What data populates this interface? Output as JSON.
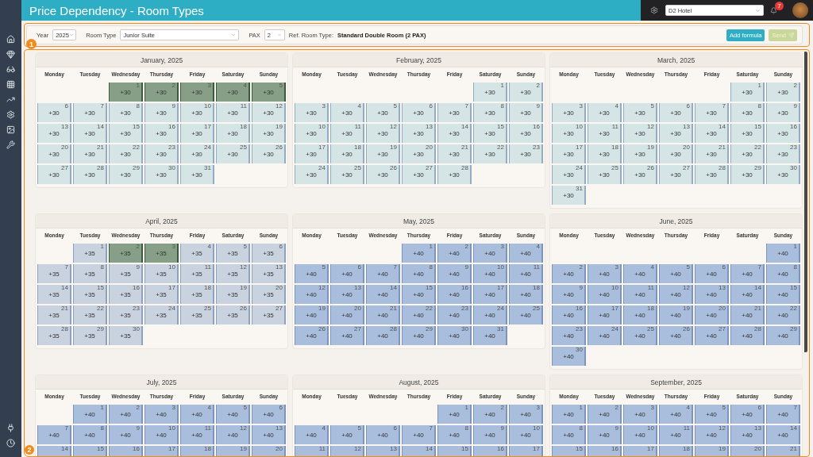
{
  "header": {
    "title": "Price Dependency - Room Types",
    "hotel_select": {
      "value": "D2 Hotel"
    },
    "notification_count": "7"
  },
  "annotations": [
    {
      "label": "1"
    },
    {
      "label": "2"
    }
  ],
  "toolbar": {
    "year": {
      "label": "Year",
      "value": "2025"
    },
    "room_type": {
      "label": "Room Type",
      "value": "Junior Suite"
    },
    "pax": {
      "label": "PAX",
      "value": "2"
    },
    "ref_room_type": {
      "label": "Ref. Room Type:",
      "value": "Standard Double Room (2 PAX)"
    },
    "buttons": [
      {
        "label": "Add formula",
        "disabled": false
      },
      {
        "label": "Send",
        "disabled": true
      }
    ]
  },
  "months": [
    {
      "title": "January, 2025",
      "color": "#d5e5e6",
      "weekdays": [
        "Monday",
        "Tuesday",
        "Wednesday",
        "Thursday",
        "Friday",
        "Saturday",
        "Sunday"
      ],
      "cells": [
        null,
        null,
        {
          "day": "1",
          "value": "+30",
          "selected": true
        },
        {
          "day": "2",
          "value": "+30",
          "selected": true
        },
        {
          "day": "3",
          "value": "+30",
          "selected": true
        },
        {
          "day": "4",
          "value": "+30",
          "selected": true
        },
        {
          "day": "5",
          "value": "+30",
          "selected": true
        },
        {
          "day": "6",
          "value": "+30",
          "selected": false
        },
        {
          "day": "7",
          "value": "+30",
          "selected": false
        },
        {
          "day": "8",
          "value": "+30",
          "selected": false
        },
        {
          "day": "9",
          "value": "+30",
          "selected": false
        },
        {
          "day": "10",
          "value": "+30",
          "selected": false
        },
        {
          "day": "11",
          "value": "+30",
          "selected": false
        },
        {
          "day": "12",
          "value": "+30",
          "selected": false
        },
        {
          "day": "13",
          "value": "+30",
          "selected": false
        },
        {
          "day": "14",
          "value": "+30",
          "selected": false
        },
        {
          "day": "15",
          "value": "+30",
          "selected": false
        },
        {
          "day": "16",
          "value": "+30",
          "selected": false
        },
        {
          "day": "17",
          "value": "+30",
          "selected": false
        },
        {
          "day": "18",
          "value": "+30",
          "selected": false
        },
        {
          "day": "19",
          "value": "+30",
          "selected": false
        },
        {
          "day": "20",
          "value": "+30",
          "selected": false
        },
        {
          "day": "21",
          "value": "+30",
          "selected": false
        },
        {
          "day": "22",
          "value": "+30",
          "selected": false
        },
        {
          "day": "23",
          "value": "+30",
          "selected": false
        },
        {
          "day": "24",
          "value": "+30",
          "selected": false
        },
        {
          "day": "25",
          "value": "+30",
          "selected": false
        },
        {
          "day": "26",
          "value": "+30",
          "selected": false
        },
        {
          "day": "27",
          "value": "+30",
          "selected": false
        },
        {
          "day": "28",
          "value": "+30",
          "selected": false
        },
        {
          "day": "29",
          "value": "+30",
          "selected": false
        },
        {
          "day": "30",
          "value": "+30",
          "selected": false
        },
        {
          "day": "31",
          "value": "+30",
          "selected": false
        }
      ]
    },
    {
      "title": "February, 2025",
      "color": "#d5e5e6",
      "weekdays": [
        "Monday",
        "Tuesday",
        "Wednesday",
        "Thursday",
        "Friday",
        "Saturday",
        "Sunday"
      ],
      "cells": [
        null,
        null,
        null,
        null,
        null,
        {
          "day": "1",
          "value": "+30",
          "selected": false
        },
        {
          "day": "2",
          "value": "+30",
          "selected": false
        },
        {
          "day": "3",
          "value": "+30",
          "selected": false
        },
        {
          "day": "4",
          "value": "+30",
          "selected": false
        },
        {
          "day": "5",
          "value": "+30",
          "selected": false
        },
        {
          "day": "6",
          "value": "+30",
          "selected": false
        },
        {
          "day": "7",
          "value": "+30",
          "selected": false
        },
        {
          "day": "8",
          "value": "+30",
          "selected": false
        },
        {
          "day": "9",
          "value": "+30",
          "selected": false
        },
        {
          "day": "10",
          "value": "+30",
          "selected": false
        },
        {
          "day": "11",
          "value": "+30",
          "selected": false
        },
        {
          "day": "12",
          "value": "+30",
          "selected": false
        },
        {
          "day": "13",
          "value": "+30",
          "selected": false
        },
        {
          "day": "14",
          "value": "+30",
          "selected": false
        },
        {
          "day": "15",
          "value": "+30",
          "selected": false
        },
        {
          "day": "16",
          "value": "+30",
          "selected": false
        },
        {
          "day": "17",
          "value": "+30",
          "selected": false
        },
        {
          "day": "18",
          "value": "+30",
          "selected": false
        },
        {
          "day": "19",
          "value": "+30",
          "selected": false
        },
        {
          "day": "20",
          "value": "+30",
          "selected": false
        },
        {
          "day": "21",
          "value": "+30",
          "selected": false
        },
        {
          "day": "22",
          "value": "+30",
          "selected": false
        },
        {
          "day": "23",
          "value": "+30",
          "selected": false
        },
        {
          "day": "24",
          "value": "+30",
          "selected": false
        },
        {
          "day": "25",
          "value": "+30",
          "selected": false
        },
        {
          "day": "26",
          "value": "+30",
          "selected": false
        },
        {
          "day": "27",
          "value": "+30",
          "selected": false
        },
        {
          "day": "28",
          "value": "+30",
          "selected": false
        }
      ]
    },
    {
      "title": "March, 2025",
      "color": "#d5e5e6",
      "weekdays": [
        "Monday",
        "Tuesday",
        "Wednesday",
        "Thursday",
        "Friday",
        "Saturday",
        "Sunday"
      ],
      "cells": [
        null,
        null,
        null,
        null,
        null,
        {
          "day": "1",
          "value": "+30",
          "selected": false
        },
        {
          "day": "2",
          "value": "+30",
          "selected": false
        },
        {
          "day": "3",
          "value": "+30",
          "selected": false
        },
        {
          "day": "4",
          "value": "+30",
          "selected": false
        },
        {
          "day": "5",
          "value": "+30",
          "selected": false
        },
        {
          "day": "6",
          "value": "+30",
          "selected": false
        },
        {
          "day": "7",
          "value": "+30",
          "selected": false
        },
        {
          "day": "8",
          "value": "+30",
          "selected": false
        },
        {
          "day": "9",
          "value": "+30",
          "selected": false
        },
        {
          "day": "10",
          "value": "+30",
          "selected": false
        },
        {
          "day": "11",
          "value": "+30",
          "selected": false
        },
        {
          "day": "12",
          "value": "+30",
          "selected": false
        },
        {
          "day": "13",
          "value": "+30",
          "selected": false
        },
        {
          "day": "14",
          "value": "+30",
          "selected": false
        },
        {
          "day": "15",
          "value": "+30",
          "selected": false
        },
        {
          "day": "16",
          "value": "+30",
          "selected": false
        },
        {
          "day": "17",
          "value": "+30",
          "selected": false
        },
        {
          "day": "18",
          "value": "+30",
          "selected": false
        },
        {
          "day": "19",
          "value": "+30",
          "selected": false
        },
        {
          "day": "20",
          "value": "+30",
          "selected": false
        },
        {
          "day": "21",
          "value": "+30",
          "selected": false
        },
        {
          "day": "22",
          "value": "+30",
          "selected": false
        },
        {
          "day": "23",
          "value": "+30",
          "selected": false
        },
        {
          "day": "24",
          "value": "+30",
          "selected": false
        },
        {
          "day": "25",
          "value": "+30",
          "selected": false
        },
        {
          "day": "26",
          "value": "+30",
          "selected": false
        },
        {
          "day": "27",
          "value": "+30",
          "selected": false
        },
        {
          "day": "28",
          "value": "+30",
          "selected": false
        },
        {
          "day": "29",
          "value": "+30",
          "selected": false
        },
        {
          "day": "30",
          "value": "+30",
          "selected": false
        },
        {
          "day": "31",
          "value": "+30",
          "selected": false
        }
      ]
    },
    {
      "title": "April, 2025",
      "color": "#c9d3e0",
      "weekdays": [
        "Monday",
        "Tuesday",
        "Wednesday",
        "Thursday",
        "Friday",
        "Saturday",
        "Sunday"
      ],
      "cells": [
        null,
        {
          "day": "1",
          "value": "+35",
          "selected": false
        },
        {
          "day": "2",
          "value": "+35",
          "selected": true
        },
        {
          "day": "3",
          "value": "+35",
          "selected": true
        },
        {
          "day": "4",
          "value": "+35",
          "selected": false
        },
        {
          "day": "5",
          "value": "+35",
          "selected": false
        },
        {
          "day": "6",
          "value": "+35",
          "selected": false
        },
        {
          "day": "7",
          "value": "+35",
          "selected": false
        },
        {
          "day": "8",
          "value": "+35",
          "selected": false
        },
        {
          "day": "9",
          "value": "+35",
          "selected": false
        },
        {
          "day": "10",
          "value": "+35",
          "selected": false
        },
        {
          "day": "11",
          "value": "+35",
          "selected": false
        },
        {
          "day": "12",
          "value": "+35",
          "selected": false
        },
        {
          "day": "13",
          "value": "+35",
          "selected": false
        },
        {
          "day": "14",
          "value": "+35",
          "selected": false
        },
        {
          "day": "15",
          "value": "+35",
          "selected": false
        },
        {
          "day": "16",
          "value": "+35",
          "selected": false
        },
        {
          "day": "17",
          "value": "+35",
          "selected": false
        },
        {
          "day": "18",
          "value": "+35",
          "selected": false
        },
        {
          "day": "19",
          "value": "+35",
          "selected": false
        },
        {
          "day": "20",
          "value": "+35",
          "selected": false
        },
        {
          "day": "21",
          "value": "+35",
          "selected": false
        },
        {
          "day": "22",
          "value": "+35",
          "selected": false
        },
        {
          "day": "23",
          "value": "+35",
          "selected": false
        },
        {
          "day": "24",
          "value": "+35",
          "selected": false
        },
        {
          "day": "25",
          "value": "+35",
          "selected": false
        },
        {
          "day": "26",
          "value": "+35",
          "selected": false
        },
        {
          "day": "27",
          "value": "+35",
          "selected": false
        },
        {
          "day": "28",
          "value": "+35",
          "selected": false
        },
        {
          "day": "29",
          "value": "+35",
          "selected": false
        },
        {
          "day": "30",
          "value": "+35",
          "selected": false
        }
      ]
    },
    {
      "title": "May, 2025",
      "color": "#a9bedd",
      "weekdays": [
        "Monday",
        "Tuesday",
        "Wednesday",
        "Thursday",
        "Friday",
        "Saturday",
        "Sunday"
      ],
      "cells": [
        null,
        null,
        null,
        {
          "day": "1",
          "value": "+40",
          "selected": false
        },
        {
          "day": "2",
          "value": "+40",
          "selected": false
        },
        {
          "day": "3",
          "value": "+40",
          "selected": false
        },
        {
          "day": "4",
          "value": "+40",
          "selected": false
        },
        {
          "day": "5",
          "value": "+40",
          "selected": false
        },
        {
          "day": "6",
          "value": "+40",
          "selected": false
        },
        {
          "day": "7",
          "value": "+40",
          "selected": false
        },
        {
          "day": "8",
          "value": "+40",
          "selected": false
        },
        {
          "day": "9",
          "value": "+40",
          "selected": false
        },
        {
          "day": "10",
          "value": "+40",
          "selected": false
        },
        {
          "day": "11",
          "value": "+40",
          "selected": false
        },
        {
          "day": "12",
          "value": "+40",
          "selected": false
        },
        {
          "day": "13",
          "value": "+40",
          "selected": false
        },
        {
          "day": "14",
          "value": "+40",
          "selected": false
        },
        {
          "day": "15",
          "value": "+40",
          "selected": false
        },
        {
          "day": "16",
          "value": "+40",
          "selected": false
        },
        {
          "day": "17",
          "value": "+40",
          "selected": false
        },
        {
          "day": "18",
          "value": "+40",
          "selected": false
        },
        {
          "day": "19",
          "value": "+40",
          "selected": false
        },
        {
          "day": "20",
          "value": "+40",
          "selected": false
        },
        {
          "day": "21",
          "value": "+40",
          "selected": false
        },
        {
          "day": "22",
          "value": "+40",
          "selected": false
        },
        {
          "day": "23",
          "value": "+40",
          "selected": false
        },
        {
          "day": "24",
          "value": "+40",
          "selected": false
        },
        {
          "day": "25",
          "value": "+40",
          "selected": false
        },
        {
          "day": "26",
          "value": "+40",
          "selected": false
        },
        {
          "day": "27",
          "value": "+40",
          "selected": false
        },
        {
          "day": "28",
          "value": "+40",
          "selected": false
        },
        {
          "day": "29",
          "value": "+40",
          "selected": false
        },
        {
          "day": "30",
          "value": "+40",
          "selected": false
        },
        {
          "day": "31",
          "value": "+40",
          "selected": false
        }
      ]
    },
    {
      "title": "June, 2025",
      "color": "#a9bedd",
      "weekdays": [
        "Monday",
        "Tuesday",
        "Wednesday",
        "Thursday",
        "Friday",
        "Saturday",
        "Sunday"
      ],
      "cells": [
        null,
        null,
        null,
        null,
        null,
        null,
        {
          "day": "1",
          "value": "+40",
          "selected": false
        },
        {
          "day": "2",
          "value": "+40",
          "selected": false
        },
        {
          "day": "3",
          "value": "+40",
          "selected": false
        },
        {
          "day": "4",
          "value": "+40",
          "selected": false
        },
        {
          "day": "5",
          "value": "+40",
          "selected": false
        },
        {
          "day": "6",
          "value": "+40",
          "selected": false
        },
        {
          "day": "7",
          "value": "+40",
          "selected": false
        },
        {
          "day": "8",
          "value": "+40",
          "selected": false
        },
        {
          "day": "9",
          "value": "+40",
          "selected": false
        },
        {
          "day": "10",
          "value": "+40",
          "selected": false
        },
        {
          "day": "11",
          "value": "+40",
          "selected": false
        },
        {
          "day": "12",
          "value": "+40",
          "selected": false
        },
        {
          "day": "13",
          "value": "+40",
          "selected": false
        },
        {
          "day": "14",
          "value": "+40",
          "selected": false
        },
        {
          "day": "15",
          "value": "+40",
          "selected": false
        },
        {
          "day": "16",
          "value": "+40",
          "selected": false
        },
        {
          "day": "17",
          "value": "+40",
          "selected": false
        },
        {
          "day": "18",
          "value": "+40",
          "selected": false
        },
        {
          "day": "19",
          "value": "+40",
          "selected": false
        },
        {
          "day": "20",
          "value": "+40",
          "selected": false
        },
        {
          "day": "21",
          "value": "+40",
          "selected": false
        },
        {
          "day": "22",
          "value": "+40",
          "selected": false
        },
        {
          "day": "23",
          "value": "+40",
          "selected": false
        },
        {
          "day": "24",
          "value": "+40",
          "selected": false
        },
        {
          "day": "25",
          "value": "+40",
          "selected": false
        },
        {
          "day": "26",
          "value": "+40",
          "selected": false
        },
        {
          "day": "27",
          "value": "+40",
          "selected": false
        },
        {
          "day": "28",
          "value": "+40",
          "selected": false
        },
        {
          "day": "29",
          "value": "+40",
          "selected": false
        },
        {
          "day": "30",
          "value": "+40",
          "selected": false
        }
      ]
    },
    {
      "title": "July, 2025",
      "color": "#a9bedd",
      "weekdays": [
        "Monday",
        "Tuesday",
        "Wednesday",
        "Thursday",
        "Friday",
        "Saturday",
        "Sunday"
      ],
      "cells": [
        null,
        {
          "day": "1",
          "value": "+40",
          "selected": false
        },
        {
          "day": "2",
          "value": "+40",
          "selected": false
        },
        {
          "day": "3",
          "value": "+40",
          "selected": false
        },
        {
          "day": "4",
          "value": "+40",
          "selected": false
        },
        {
          "day": "5",
          "value": "+40",
          "selected": false
        },
        {
          "day": "6",
          "value": "+40",
          "selected": false
        },
        {
          "day": "7",
          "value": "+40",
          "selected": false
        },
        {
          "day": "8",
          "value": "+40",
          "selected": false
        },
        {
          "day": "9",
          "value": "+40",
          "selected": false
        },
        {
          "day": "10",
          "value": "+40",
          "selected": false
        },
        {
          "day": "11",
          "value": "+40",
          "selected": false
        },
        {
          "day": "12",
          "value": "+40",
          "selected": false
        },
        {
          "day": "13",
          "value": "+40",
          "selected": false
        },
        {
          "day": "14",
          "selected": false
        },
        {
          "day": "15",
          "selected": false
        },
        {
          "day": "16",
          "selected": false
        },
        {
          "day": "17",
          "selected": false
        },
        {
          "day": "18",
          "selected": false
        },
        {
          "day": "19",
          "selected": false
        },
        {
          "day": "20",
          "selected": false
        }
      ]
    },
    {
      "title": "August, 2025",
      "color": "#a9bedd",
      "weekdays": [
        "Monday",
        "Tuesday",
        "Wednesday",
        "Thursday",
        "Friday",
        "Saturday",
        "Sunday"
      ],
      "cells": [
        null,
        null,
        null,
        null,
        {
          "day": "1",
          "value": "+40",
          "selected": false
        },
        {
          "day": "2",
          "value": "+40",
          "selected": false
        },
        {
          "day": "3",
          "value": "+40",
          "selected": false
        },
        {
          "day": "4",
          "value": "+40",
          "selected": false
        },
        {
          "day": "5",
          "value": "+40",
          "selected": false
        },
        {
          "day": "6",
          "value": "+40",
          "selected": false
        },
        {
          "day": "7",
          "value": "+40",
          "selected": false
        },
        {
          "day": "8",
          "value": "+40",
          "selected": false
        },
        {
          "day": "9",
          "value": "+40",
          "selected": false
        },
        {
          "day": "10",
          "value": "+40",
          "selected": false
        },
        {
          "day": "11",
          "selected": false
        },
        {
          "day": "12",
          "selected": false
        },
        {
          "day": "13",
          "selected": false
        },
        {
          "day": "14",
          "selected": false
        },
        {
          "day": "15",
          "selected": false
        },
        {
          "day": "16",
          "selected": false
        },
        {
          "day": "17",
          "selected": false
        }
      ]
    },
    {
      "title": "September, 2025",
      "color": "#a9bedd",
      "weekdays": [
        "Monday",
        "Tuesday",
        "Wednesday",
        "Thursday",
        "Friday",
        "Saturday",
        "Sunday"
      ],
      "cells": [
        {
          "day": "1",
          "value": "+40",
          "selected": false
        },
        {
          "day": "2",
          "value": "+40",
          "selected": false
        },
        {
          "day": "3",
          "value": "+40",
          "selected": false
        },
        {
          "day": "4",
          "value": "+40",
          "selected": false
        },
        {
          "day": "5",
          "value": "+40",
          "selected": false
        },
        {
          "day": "6",
          "value": "+40",
          "selected": false
        },
        {
          "day": "7",
          "value": "+40",
          "selected": false
        },
        {
          "day": "8",
          "value": "+40",
          "selected": false
        },
        {
          "day": "9",
          "value": "+40",
          "selected": false
        },
        {
          "day": "10",
          "value": "+40",
          "selected": false
        },
        {
          "day": "11",
          "value": "+40",
          "selected": false
        },
        {
          "day": "12",
          "value": "+40",
          "selected": false
        },
        {
          "day": "13",
          "value": "+40",
          "selected": false
        },
        {
          "day": "14",
          "value": "+40",
          "selected": false
        },
        {
          "day": "15",
          "selected": false
        },
        {
          "day": "16",
          "selected": false
        },
        {
          "day": "17",
          "selected": false
        },
        {
          "day": "18",
          "selected": false
        },
        {
          "day": "19",
          "selected": false
        },
        {
          "day": "20",
          "selected": false
        },
        {
          "day": "21",
          "selected": false
        }
      ]
    }
  ]
}
